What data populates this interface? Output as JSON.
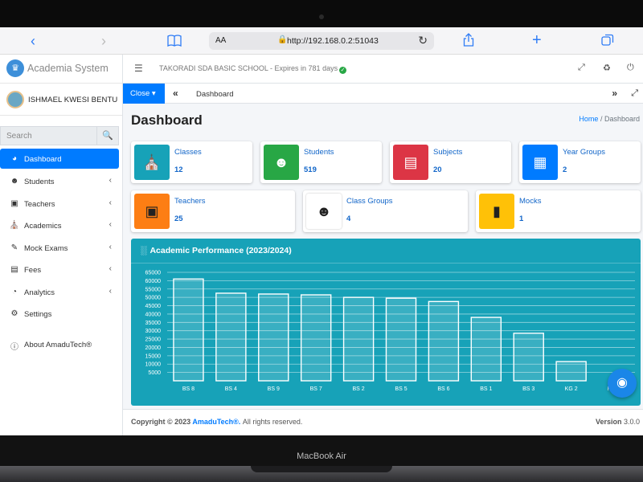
{
  "browser": {
    "text_size_label": "AA",
    "url": "http://192.168.0.2:51043",
    "back_icon": "chevron-left",
    "forward_icon": "chevron-right",
    "bookmarks_icon": "book",
    "share_icon": "share",
    "new_tab_icon": "plus",
    "tabs_icon": "tabs"
  },
  "sidebar": {
    "brand": "Academia System",
    "user_name": "ISHMAEL KWESI BENTU",
    "search_placeholder": "Search",
    "items": [
      {
        "label": "Dashboard",
        "icon": "dashboard",
        "active": true,
        "has_arrow": false
      },
      {
        "label": "Students",
        "icon": "users",
        "active": false,
        "has_arrow": true
      },
      {
        "label": "Teachers",
        "icon": "chalkboard",
        "active": false,
        "has_arrow": true
      },
      {
        "label": "Academics",
        "icon": "school",
        "active": false,
        "has_arrow": true
      },
      {
        "label": "Mock Exams",
        "icon": "edit",
        "active": false,
        "has_arrow": true
      },
      {
        "label": "Fees",
        "icon": "card",
        "active": false,
        "has_arrow": true
      },
      {
        "label": "Analytics",
        "icon": "pie",
        "active": false,
        "has_arrow": true
      },
      {
        "label": "Settings",
        "icon": "gear",
        "active": false,
        "has_arrow": false
      },
      {
        "label": "About AmaduTech®",
        "icon": "info",
        "active": false,
        "has_arrow": false
      }
    ]
  },
  "topnav": {
    "school": "TAKORADI SDA BASIC SCHOOL - Expires in 781 days"
  },
  "tabbar": {
    "close_label": "Close",
    "tab_label": "Dashboard"
  },
  "page": {
    "title": "Dashboard",
    "breadcrumb_home": "Home",
    "breadcrumb_sep": "/",
    "breadcrumb_current": "Dashboard"
  },
  "stats": [
    {
      "title": "Classes",
      "count": "12",
      "color": "#17a2b8",
      "icon": "school"
    },
    {
      "title": "Students",
      "count": "519",
      "color": "#28a745",
      "icon": "users"
    },
    {
      "title": "Subjects",
      "count": "20",
      "color": "#dc3545",
      "icon": "book"
    },
    {
      "title": "Year Groups",
      "count": "2",
      "color": "#007bff",
      "icon": "calendar"
    },
    {
      "title": "Teachers",
      "count": "25",
      "color": "#fd7e14",
      "icon": "chalkboard"
    },
    {
      "title": "Class Groups",
      "count": "4",
      "color": "#ffffff",
      "icon": "users-group"
    },
    {
      "title": "Mocks",
      "count": "1",
      "color": "#ffc107",
      "icon": "file"
    }
  ],
  "chart_card": {
    "title": "Academic Performance (2023/2024)"
  },
  "chart_data": {
    "type": "bar",
    "title": "Academic Performance (2023/2024)",
    "categories": [
      "BS 8",
      "BS 4",
      "BS 9",
      "BS 7",
      "BS 2",
      "BS 5",
      "BS 6",
      "BS 1",
      "BS 3",
      "KG 2",
      "KG 1"
    ],
    "values": [
      61000,
      52500,
      52000,
      51500,
      50000,
      49500,
      47500,
      38000,
      28500,
      11500,
      0
    ],
    "ylim": [
      0,
      65000
    ],
    "yticks": [
      5000,
      10000,
      15000,
      20000,
      25000,
      30000,
      35000,
      40000,
      45000,
      50000,
      55000,
      60000,
      65000
    ],
    "grid": true,
    "bar_fill": "rgba(255,255,255,0.15)",
    "bar_stroke": "#ffffff"
  },
  "footer": {
    "copyright_prefix": "Copyright © 2023",
    "brand": "AmaduTech®.",
    "rights": "All rights reserved.",
    "version_label": "Version",
    "version": "3.0.0"
  },
  "device": {
    "model": "MacBook Air"
  }
}
